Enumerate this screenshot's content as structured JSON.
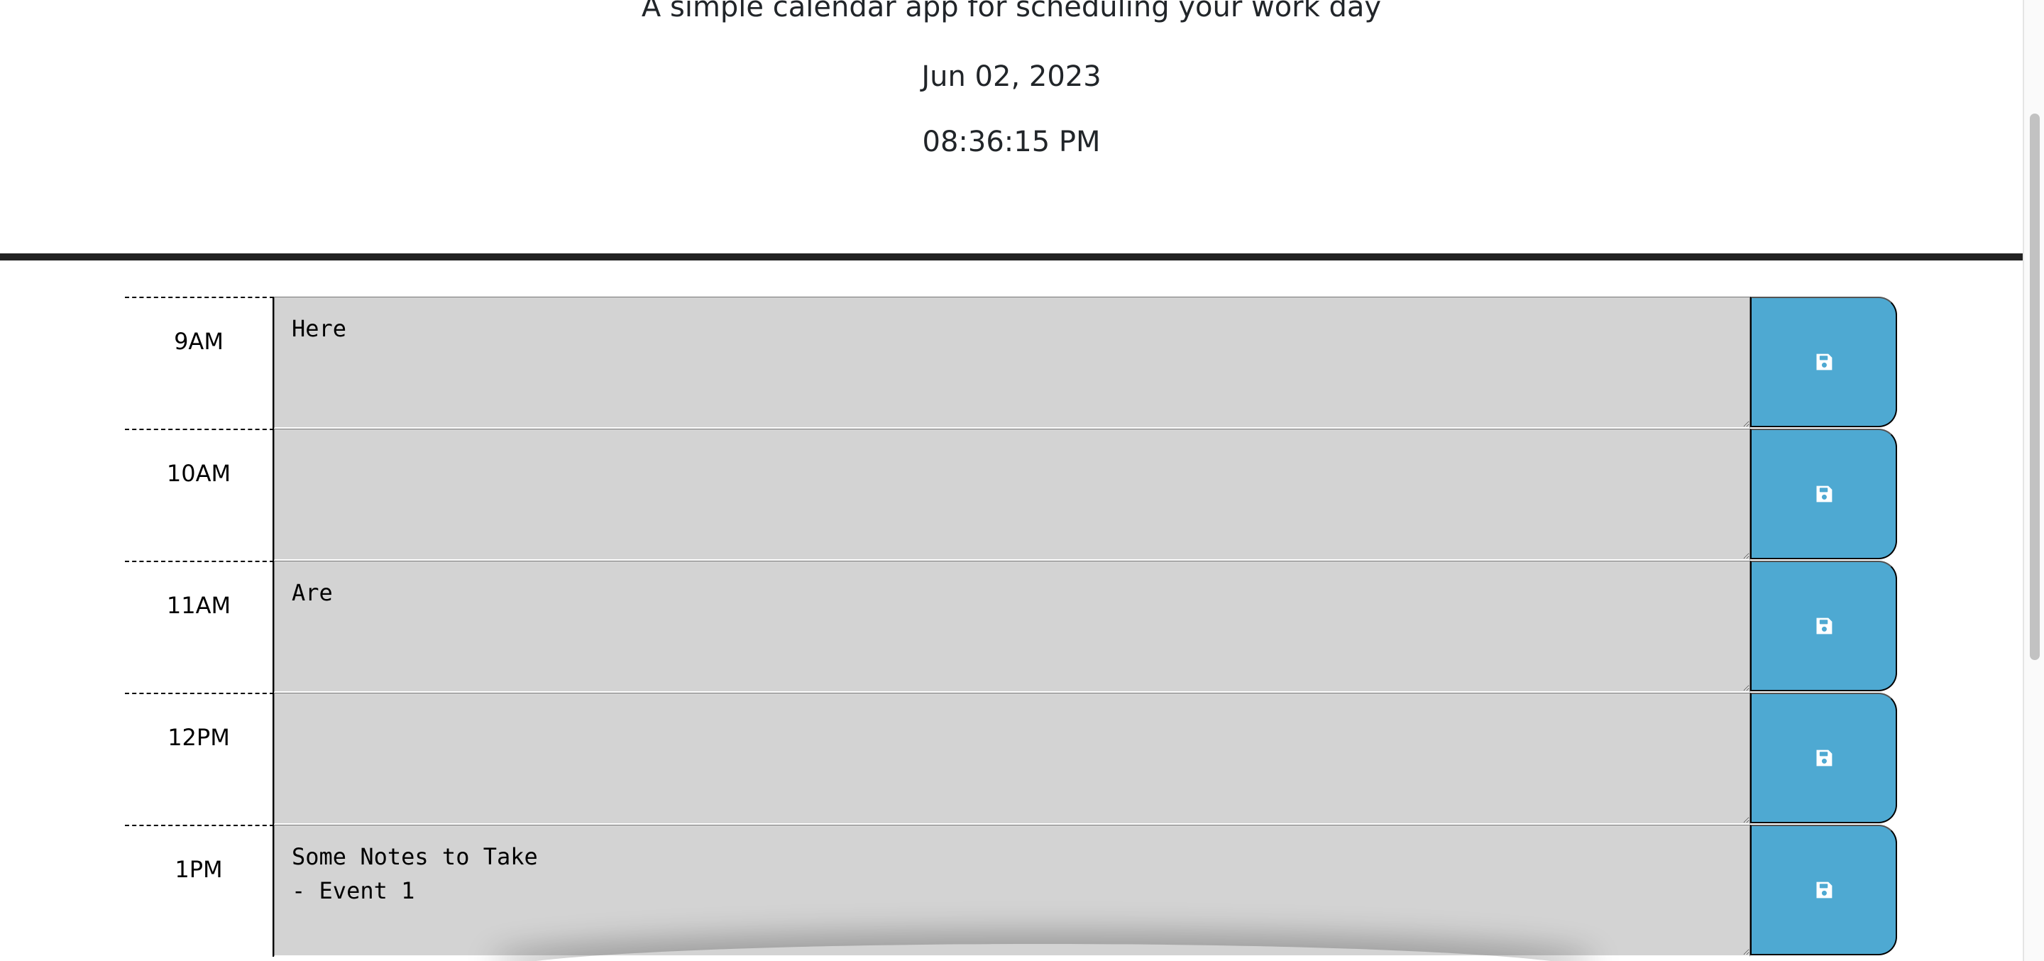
{
  "header": {
    "lead": "A simple calendar app for scheduling your work day",
    "current_date": "Jun 02, 2023",
    "current_time": "08:36:15 PM"
  },
  "colors": {
    "save_button": "#4ea9d2",
    "past_row": "#d3d3d3",
    "divider": "#222222"
  },
  "icons": {
    "save": "save-icon"
  },
  "schedule": {
    "rows": [
      {
        "hour": "9AM",
        "text": "Here"
      },
      {
        "hour": "10AM",
        "text": ""
      },
      {
        "hour": "11AM",
        "text": "Are"
      },
      {
        "hour": "12PM",
        "text": ""
      },
      {
        "hour": "1PM",
        "text": "Some Notes to Take\n- Event 1"
      }
    ]
  }
}
